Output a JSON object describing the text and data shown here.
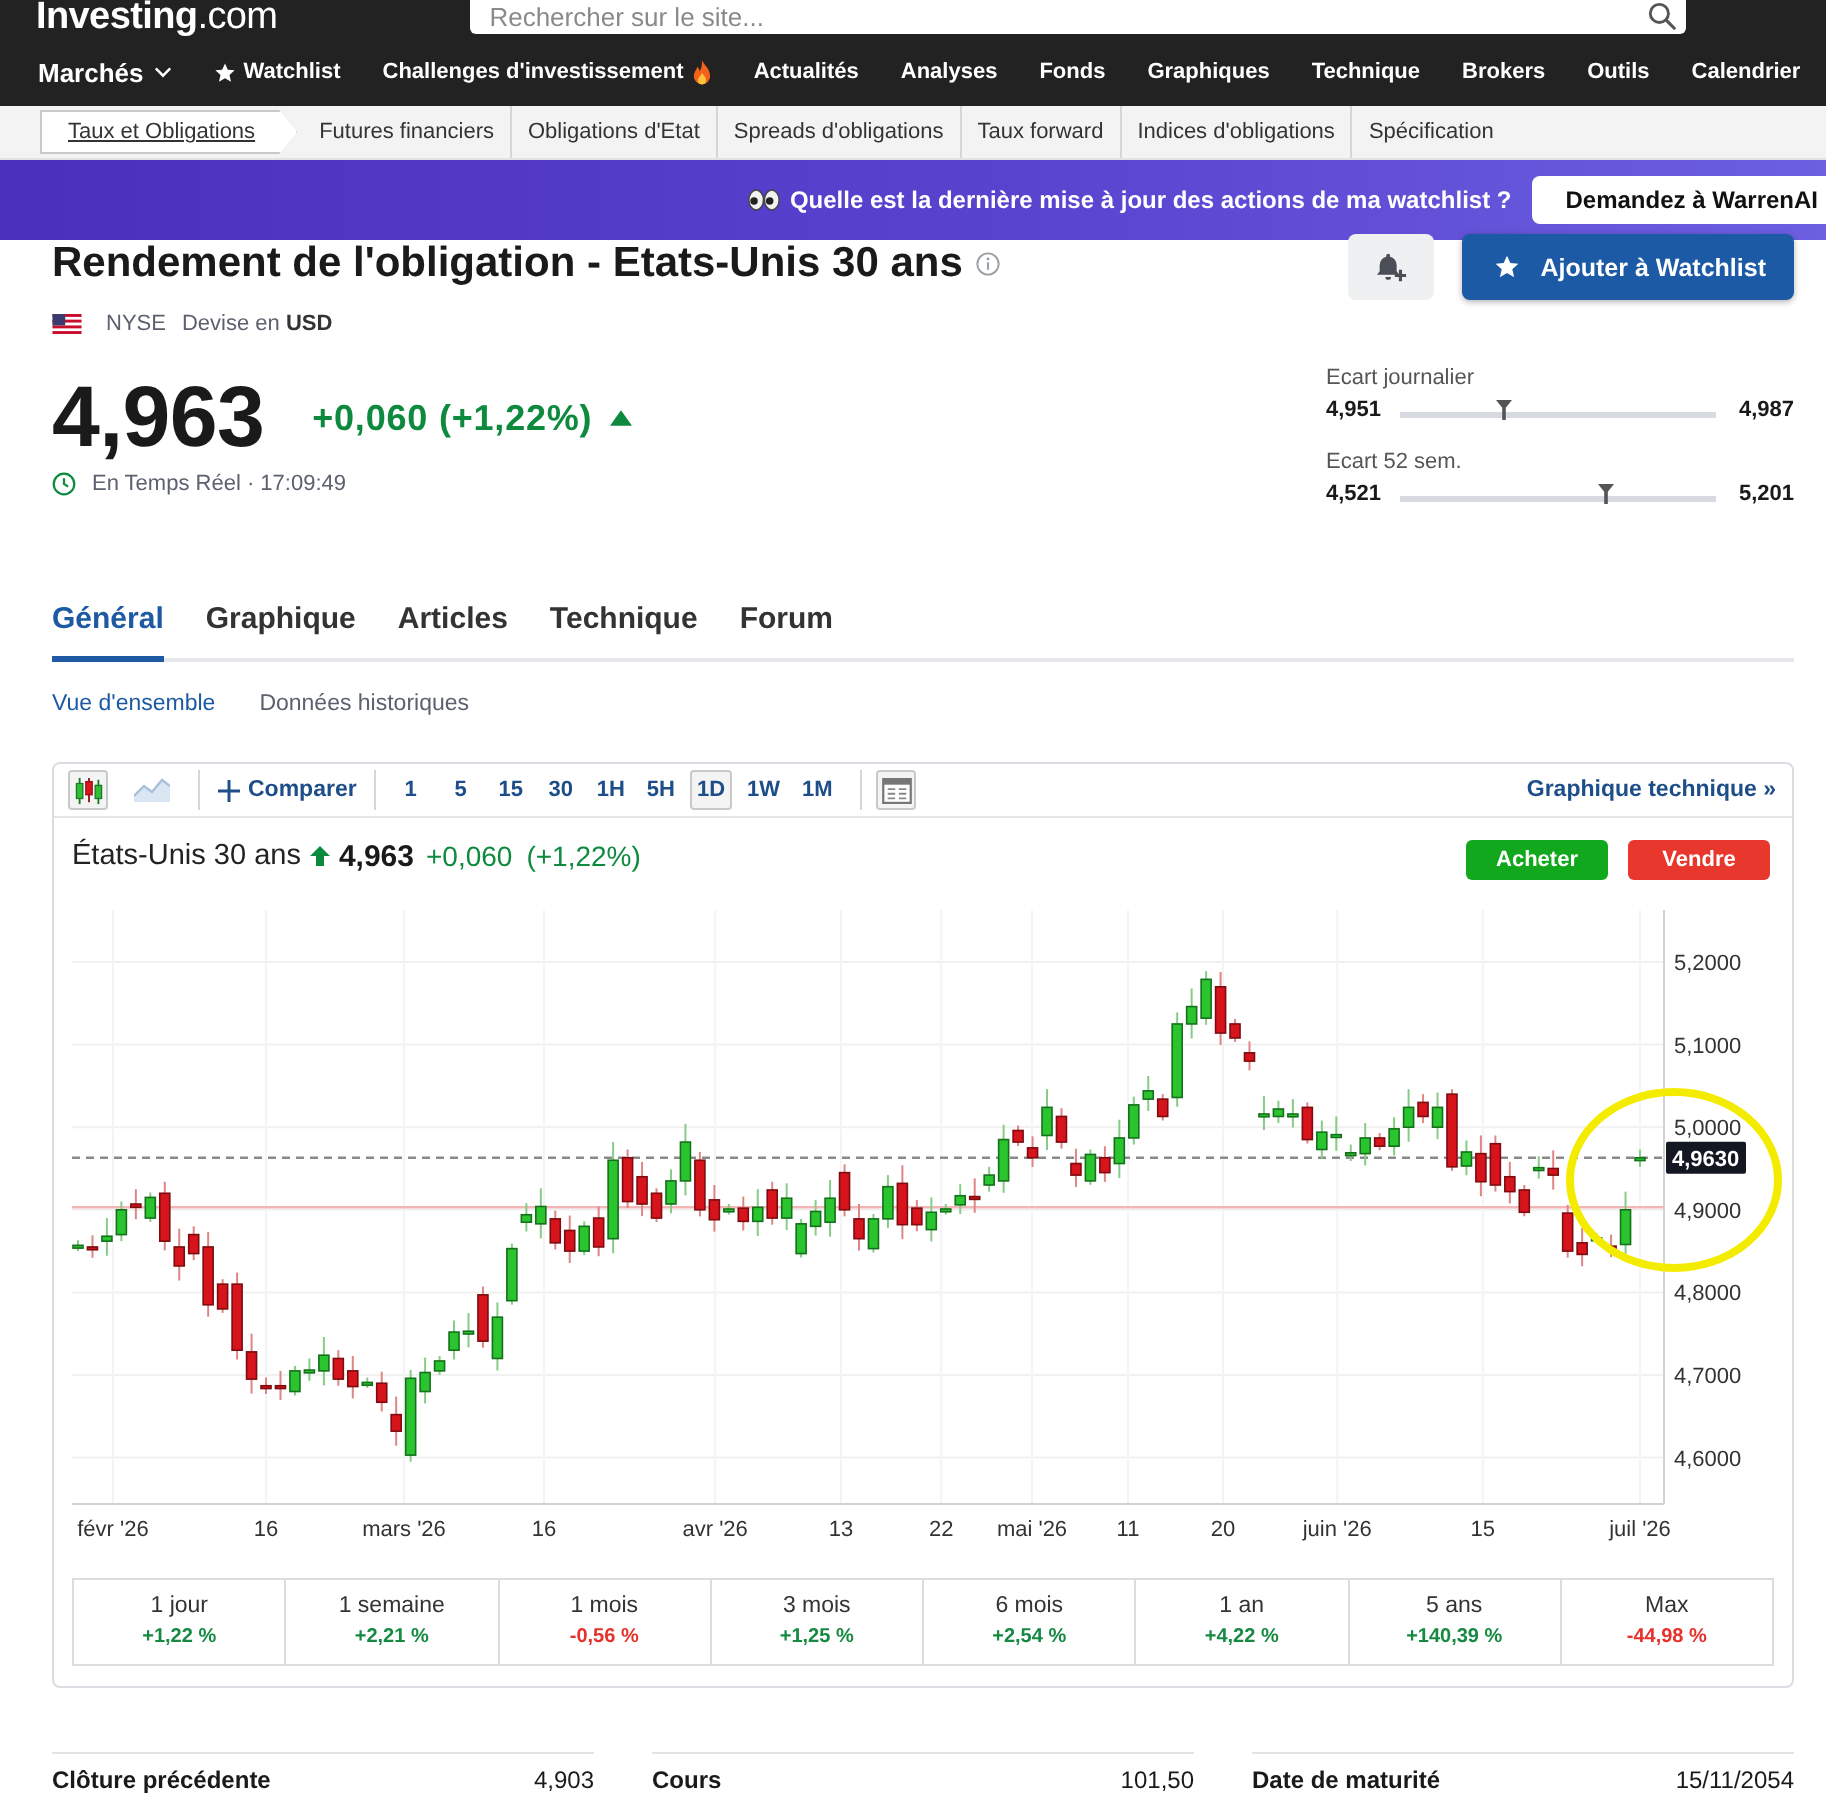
{
  "header": {
    "logo": "**Investing**.com",
    "search": {
      "placeholder": "Rechercher sur le site..."
    }
  },
  "nav": [
    {
      "label": "Marchés",
      "kind": "menu"
    },
    {
      "label": "Watchlist",
      "kind": "star"
    },
    {
      "label": "Challenges d'investissement",
      "kind": "hot"
    },
    {
      "label": "Actualités",
      "kind": "link"
    },
    {
      "label": "Analyses",
      "kind": "link"
    },
    {
      "label": "Fonds",
      "kind": "link"
    },
    {
      "label": "Graphiques",
      "kind": "link"
    },
    {
      "label": "Technique",
      "kind": "link"
    },
    {
      "label": "Brokers",
      "kind": "link"
    },
    {
      "label": "Outils",
      "kind": "link"
    },
    {
      "label": "Calendrier",
      "kind": "link"
    }
  ],
  "subnav": [
    {
      "label": "Taux et Obligations",
      "selected": true
    },
    {
      "label": "Futures financiers",
      "selected": false
    },
    {
      "label": "Obligations d'Etat",
      "selected": false
    },
    {
      "label": "Spreads d'obligations",
      "selected": false
    },
    {
      "label": "Taux forward",
      "selected": false
    },
    {
      "label": "Indices d'obligations",
      "selected": false
    },
    {
      "label": "Spécification",
      "selected": false
    }
  ],
  "banner": {
    "text": "Quelle est la dernière mise à jour des actions de ma watchlist ?",
    "button": "Demandez à WarrenAI"
  },
  "instrument": {
    "title": "Rendement de l'obligation - Etats-Unis 30 ans",
    "exchange": "NYSE",
    "currency": "Devise en **USD**",
    "price": "4,963",
    "change": "+0,060 (+1,22%)",
    "rising": true,
    "status": "En Temps Réel · 17:09:49",
    "watchlist_button": "Ajouter à Watchlist"
  },
  "ranges": [
    {
      "label": "Ecart journalier",
      "low": "4,951",
      "high": "4,987",
      "level": 0.33
    },
    {
      "label": "Ecart 52 sem.",
      "low": "4,521",
      "high": "5,201",
      "level": 0.65
    }
  ],
  "tabs": [
    {
      "label": "Général",
      "selected": true
    },
    {
      "label": "Graphique",
      "selected": false
    },
    {
      "label": "Articles",
      "selected": false
    },
    {
      "label": "Technique",
      "selected": false
    },
    {
      "label": "Forum",
      "selected": false
    }
  ],
  "subtabs": [
    {
      "label": "Vue d'ensemble",
      "selected": true
    },
    {
      "label": "Données historiques",
      "selected": false
    }
  ],
  "chart_panel": {
    "toolbar": {
      "chart_types": [
        {
          "kind": "candles",
          "selected": true
        },
        {
          "kind": "area",
          "selected": false
        }
      ],
      "compare": "Comparer",
      "intervals": [
        {
          "label": "1",
          "selected": false
        },
        {
          "label": "5",
          "selected": false
        },
        {
          "label": "15",
          "selected": false
        },
        {
          "label": "30",
          "selected": false
        },
        {
          "label": "1H",
          "selected": false
        },
        {
          "label": "5H",
          "selected": false
        },
        {
          "label": "1D",
          "selected": true
        },
        {
          "label": "1W",
          "selected": false
        },
        {
          "label": "1M",
          "selected": false
        }
      ],
      "technical_link": "Graphique technique »"
    },
    "instrument": "États-Unis 30 ans",
    "rising": true,
    "price": "4,963",
    "change": "+0,060",
    "change_percent": "(+1,22%)",
    "buy_button": "Acheter",
    "sell_button": "Vendre",
    "y_axis_labels": [
      "5,2000",
      "5,1000",
      "5,0000",
      "4,9000",
      "4,8000",
      "4,7000",
      "4,6000"
    ],
    "x_axis_labels": [
      "févr '26",
      "16",
      "mars '26",
      "16",
      "avr '26",
      "13",
      "22",
      "mai '26",
      "11",
      "20",
      "juin '26",
      "15",
      "juil '26"
    ],
    "price_tag": "4,9630",
    "performance": [
      {
        "period": "1 jour",
        "change": "+1,22 %",
        "color": "#168a43"
      },
      {
        "period": "1 semaine",
        "change": "+2,21 %",
        "color": "#168a43"
      },
      {
        "period": "1 mois",
        "change": "-0,56 %",
        "color": "#e5322d"
      },
      {
        "period": "3 mois",
        "change": "+1,25 %",
        "color": "#168a43"
      },
      {
        "period": "6 mois",
        "change": "+2,54 %",
        "color": "#168a43"
      },
      {
        "period": "1 an",
        "change": "+4,22 %",
        "color": "#168a43"
      },
      {
        "period": "5 ans",
        "change": "+140,39 %",
        "color": "#168a43"
      },
      {
        "period": "Max",
        "change": "-44,98 %",
        "color": "#e5322d"
      }
    ]
  },
  "stats": [
    {
      "label": "Clôture précédente",
      "value": "4,903"
    },
    {
      "label": "Cours",
      "value": "101,50"
    },
    {
      "label": "Date de maturité",
      "value": "15/11/2054"
    }
  ]
}
